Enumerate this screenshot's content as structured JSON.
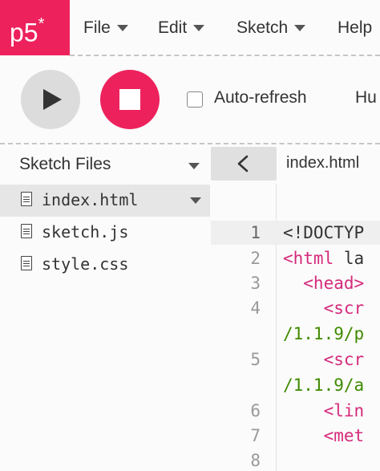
{
  "app": {
    "logo": "p5",
    "logo_star": "*"
  },
  "menu": [
    {
      "label": "File"
    },
    {
      "label": "Edit"
    },
    {
      "label": "Sketch"
    },
    {
      "label": "Help"
    }
  ],
  "toolbar": {
    "autorefresh_label": "Auto-refresh",
    "autorefresh_checked": false,
    "truncated_label": "Hu"
  },
  "sidebar": {
    "title": "Sketch Files",
    "files": [
      {
        "name": "index.html",
        "selected": true
      },
      {
        "name": "sketch.js",
        "selected": false
      },
      {
        "name": "style.css",
        "selected": false
      }
    ]
  },
  "editor": {
    "tab_name": "index.html",
    "lines": [
      {
        "num": "",
        "segments": []
      },
      {
        "num": "1",
        "segments": [
          {
            "t": "<!DOCTYP",
            "c": "plain"
          }
        ]
      },
      {
        "num": "2",
        "segments": [
          {
            "t": "<html",
            "c": "tag"
          },
          {
            "t": " la",
            "c": "plain"
          }
        ]
      },
      {
        "num": "3",
        "segments": [
          {
            "t": "  <head>",
            "c": "tag"
          }
        ]
      },
      {
        "num": "4",
        "segments": [
          {
            "t": "    <scr",
            "c": "tag"
          }
        ]
      },
      {
        "num": "",
        "segments": [
          {
            "t": "/1.1.9/p",
            "c": "green"
          }
        ]
      },
      {
        "num": "5",
        "segments": [
          {
            "t": "    <scr",
            "c": "tag"
          }
        ]
      },
      {
        "num": "",
        "segments": [
          {
            "t": "/1.1.9/a",
            "c": "green"
          }
        ]
      },
      {
        "num": "6",
        "segments": [
          {
            "t": "    <lin",
            "c": "tag"
          }
        ]
      },
      {
        "num": "7",
        "segments": [
          {
            "t": "    <met",
            "c": "tag"
          }
        ]
      },
      {
        "num": "8",
        "segments": []
      }
    ]
  },
  "colors": {
    "accent": "#ed225d",
    "tag": "#d52a7a",
    "string": "#3f8a00"
  }
}
